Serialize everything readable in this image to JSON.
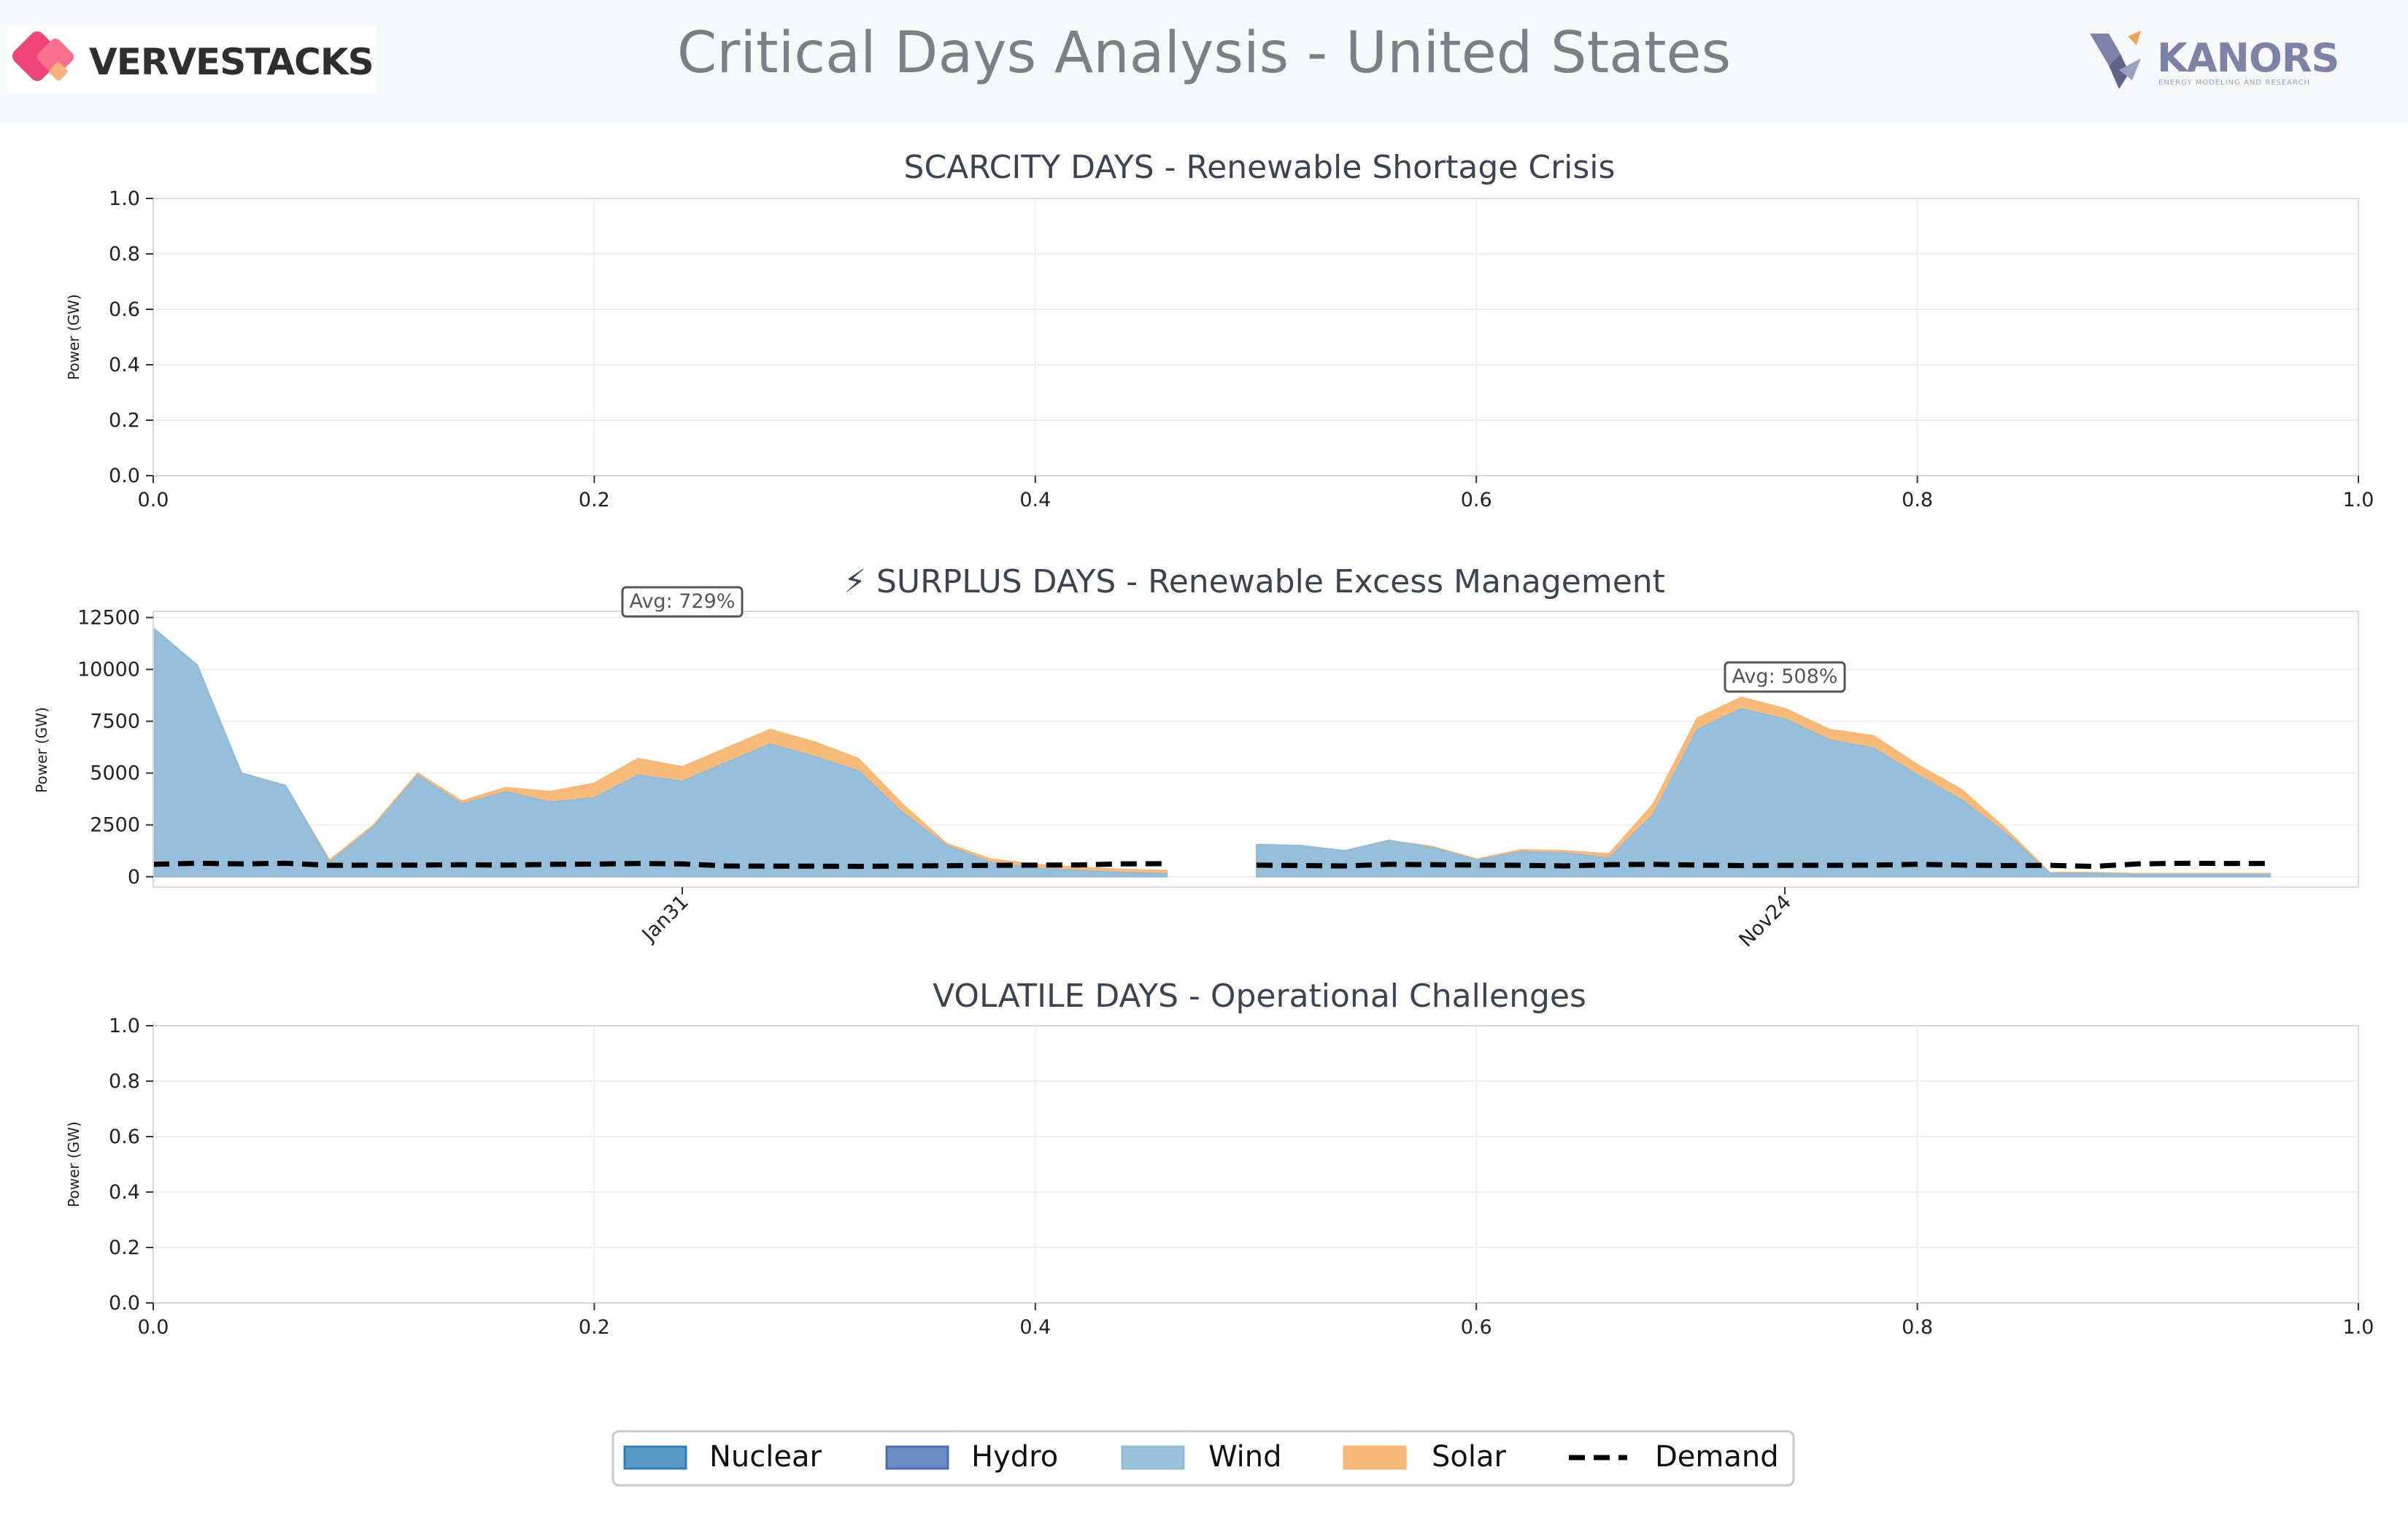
{
  "header": {
    "title": "Critical Days Analysis - United States",
    "left_logo_text": "VERVESTACKS",
    "right_logo_text": "KANORS",
    "right_logo_tagline": "ENERGY MODELING AND RESEARCH"
  },
  "colors": {
    "nuclear": "#2f7fb8",
    "hydro": "#4a6fb5",
    "wind": "#8fbcd9",
    "solar": "#f8b672",
    "demand": "#000000",
    "grid": "#eeeeee",
    "title_text": "#3d4450"
  },
  "panels": {
    "scarcity": {
      "title": " SCARCITY DAYS - Renewable Shortage Crisis",
      "ylabel": "Power (GW)",
      "x_ticks": [
        "0.0",
        "0.2",
        "0.4",
        "0.6",
        "0.8",
        "1.0"
      ],
      "y_ticks": [
        "0.0",
        "0.2",
        "0.4",
        "0.6",
        "0.8",
        "1.0"
      ]
    },
    "surplus": {
      "title": "⚡ SURPLUS DAYS - Renewable Excess Management",
      "ylabel": "Power (GW)",
      "y_ticks": [
        "0",
        "2500",
        "5000",
        "7500",
        "10000",
        "12500"
      ],
      "x_ticks": [
        "Jan31",
        "Nov24"
      ],
      "annotations": [
        "Avg: 729%",
        "Avg: 508%"
      ]
    },
    "volatile": {
      "title": " VOLATILE DAYS - Operational Challenges",
      "ylabel": "Power (GW)",
      "x_ticks": [
        "0.0",
        "0.2",
        "0.4",
        "0.6",
        "0.8",
        "1.0"
      ],
      "y_ticks": [
        "0.0",
        "0.2",
        "0.4",
        "0.6",
        "0.8",
        "1.0"
      ]
    }
  },
  "legend": {
    "nuclear": "Nuclear",
    "hydro": "Hydro",
    "wind": "Wind",
    "solar": "Solar",
    "demand": "Demand"
  },
  "chart_data": [
    {
      "type": "area",
      "title": " SCARCITY DAYS - Renewable Shortage Crisis",
      "ylabel": "Power (GW)",
      "xlim": [
        0,
        1
      ],
      "ylim": [
        0,
        1
      ],
      "grid": true,
      "series": []
    },
    {
      "type": "area",
      "title": "⚡ SURPLUS DAYS - Renewable Excess Management",
      "ylabel": "Power (GW)",
      "ylim": [
        -500,
        12800
      ],
      "grid": true,
      "stacking": "stacked",
      "legend_position": "bottom-center",
      "days": [
        {
          "label": "Jan31",
          "avg_label": "Avg: 729%",
          "wind": [
            12000,
            10200,
            5000,
            4400,
            700,
            2400,
            4900,
            3500,
            4100,
            3600,
            3800,
            4900,
            4600,
            5500,
            6400,
            5800,
            5100,
            3100,
            1500,
            700,
            400,
            300,
            200,
            150
          ],
          "solar": [
            0,
            0,
            0,
            0,
            100,
            100,
            100,
            150,
            200,
            500,
            700,
            800,
            700,
            700,
            700,
            700,
            600,
            400,
            100,
            150,
            200,
            150,
            150,
            150
          ],
          "demand": [
            600,
            650,
            620,
            650,
            550,
            560,
            560,
            580,
            560,
            600,
            610,
            640,
            620,
            520,
            510,
            510,
            500,
            520,
            530,
            550,
            560,
            570,
            620,
            630
          ]
        },
        {
          "label": "Nov24",
          "avg_label": "Avg: 508%",
          "wind": [
            1550,
            1500,
            1250,
            1750,
            1400,
            800,
            1200,
            1150,
            900,
            3000,
            7100,
            8100,
            7600,
            6600,
            6200,
            4900,
            3700,
            2100,
            150,
            150,
            100,
            100,
            100,
            100
          ],
          "solar": [
            0,
            0,
            0,
            0,
            50,
            50,
            100,
            100,
            200,
            500,
            550,
            550,
            500,
            500,
            600,
            500,
            500,
            200,
            50,
            50,
            50,
            50,
            50,
            50
          ],
          "demand": [
            560,
            540,
            520,
            600,
            580,
            560,
            550,
            520,
            580,
            600,
            560,
            540,
            550,
            550,
            560,
            600,
            560,
            540,
            550,
            500,
            620,
            650,
            640,
            640
          ]
        }
      ],
      "series": [
        {
          "name": "Nuclear",
          "values": []
        },
        {
          "name": "Hydro",
          "values": []
        },
        {
          "name": "Wind",
          "values": "see days[].wind"
        },
        {
          "name": "Solar",
          "values": "see days[].solar"
        },
        {
          "name": "Demand",
          "values": "see days[].demand"
        }
      ]
    },
    {
      "type": "area",
      "title": " VOLATILE DAYS - Operational Challenges",
      "ylabel": "Power (GW)",
      "xlim": [
        0,
        1
      ],
      "ylim": [
        0,
        1
      ],
      "grid": true,
      "series": []
    }
  ]
}
